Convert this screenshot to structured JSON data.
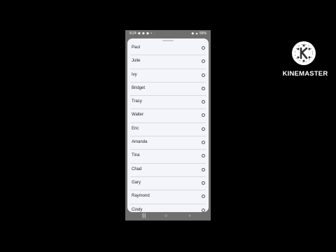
{
  "status_bar": {
    "time": "8:24",
    "left_icons": "◾ ◾ ◾ • ·",
    "right_icons": "◆ ▲ 56%"
  },
  "contact_list": [
    {
      "name": "Paul",
      "selected": false
    },
    {
      "name": "Julie",
      "selected": false
    },
    {
      "name": "Ivy",
      "selected": false
    },
    {
      "name": "Bridget",
      "selected": false
    },
    {
      "name": "Tracy",
      "selected": false
    },
    {
      "name": "Walter",
      "selected": false
    },
    {
      "name": "Eric",
      "selected": false
    },
    {
      "name": "Amanda",
      "selected": false
    },
    {
      "name": "Tina",
      "selected": false
    },
    {
      "name": "Chad",
      "selected": false
    },
    {
      "name": "Gary",
      "selected": false
    },
    {
      "name": "Raymond",
      "selected": false
    },
    {
      "name": "Cindy",
      "selected": false
    }
  ],
  "nav_bar": {
    "recent_icon": "recent-apps-icon",
    "recent_glyph": "|||",
    "home_icon": "home-icon",
    "home_glyph": "○",
    "back_icon": "back-icon",
    "back_glyph": "‹"
  },
  "watermark": {
    "brand": "KINEMASTER",
    "icon": "kinemaster-logo-icon"
  },
  "colors": {
    "background": "#000000",
    "phone_frame": "#6f6f6f",
    "sheet": "#f4f5fb",
    "divider": "#d9dae0",
    "text": "#222222"
  }
}
